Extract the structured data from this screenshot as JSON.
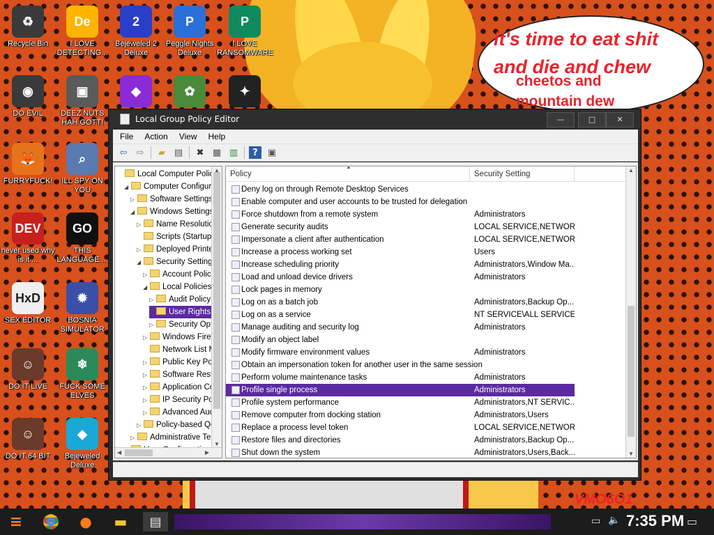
{
  "wallpaper": {
    "speech_line1": "it's time to eat shit",
    "speech_line2": "and die and chew",
    "speech_line3": "cheetos and",
    "speech_line4": "mountain dew",
    "corner_text": "VMO6O1"
  },
  "desktop_icons": [
    {
      "label": "Recycle Bin",
      "glyph": "♻",
      "color": "#3a3a3a"
    },
    {
      "label": "I LOVE DETECTING...",
      "glyph": "De",
      "color": "#ffb400"
    },
    {
      "label": "Bejeweled 2 Deluxe",
      "glyph": "2",
      "color": "#2a3fc8"
    },
    {
      "label": "Peggle Nights Deluxe",
      "glyph": "P",
      "color": "#2b6fd8"
    },
    {
      "label": "I LOVE RANSOMWARE",
      "glyph": "P",
      "color": "#0f8a5f"
    },
    {
      "label": "DO EVIL",
      "glyph": "◉",
      "color": "#3a3a3a"
    },
    {
      "label": "DEEZ NUTS HAH GOTTI",
      "glyph": "▣",
      "color": "#5a5a5a"
    },
    {
      "label": "",
      "glyph": "◆",
      "color": "#8b2bd8"
    },
    {
      "label": "",
      "glyph": "✿",
      "color": "#4a8a3a"
    },
    {
      "label": "",
      "glyph": "✦",
      "color": "#222"
    },
    {
      "label": "FURRYFUCK!",
      "glyph": "🦊",
      "color": "#e6731a"
    },
    {
      "label": "ILL SPY ON YOU",
      "glyph": "⌕",
      "color": "#5a7ab0"
    },
    {
      "label": "never used why is it ...",
      "glyph": "DEV",
      "color": "#c8201c"
    },
    {
      "label": "THIS LANGUAGE ...",
      "glyph": "GO",
      "color": "#101010"
    },
    {
      "label": "SEX EDITOR",
      "glyph": "HxD",
      "color": "#efefef"
    },
    {
      "label": "BOSNIA SIMULATOR",
      "glyph": "✹",
      "color": "#3a4fa8"
    },
    {
      "label": "DO IT LIVE",
      "glyph": "☺",
      "color": "#6a3a2a"
    },
    {
      "label": "FUCK SOME ELVES",
      "glyph": "❄",
      "color": "#2a8a5a"
    },
    {
      "label": "DO IT 64 BIT",
      "glyph": "☺",
      "color": "#6a3a2a"
    },
    {
      "label": "Bejeweled Deluxe",
      "glyph": "◆",
      "color": "#1aa8d8"
    }
  ],
  "window": {
    "title": "Local Group Policy Editor",
    "minimize": "—",
    "maximize": "□",
    "close": "✕",
    "menu": [
      "File",
      "Action",
      "View",
      "Help"
    ]
  },
  "tree": [
    {
      "label": "Local Computer Policy",
      "indent": 0,
      "arrow": "",
      "selected": false
    },
    {
      "label": "Computer Configuration",
      "indent": 1,
      "arrow": "◢",
      "selected": false
    },
    {
      "label": "Software Settings",
      "indent": 2,
      "arrow": "▷",
      "selected": false
    },
    {
      "label": "Windows Settings",
      "indent": 2,
      "arrow": "◢",
      "selected": false
    },
    {
      "label": "Name Resolution Policy",
      "indent": 3,
      "arrow": "▷",
      "selected": false
    },
    {
      "label": "Scripts (Startup/Shutdown)",
      "indent": 3,
      "arrow": "",
      "selected": false
    },
    {
      "label": "Deployed Printers",
      "indent": 3,
      "arrow": "▷",
      "selected": false
    },
    {
      "label": "Security Settings",
      "indent": 3,
      "arrow": "◢",
      "selected": false
    },
    {
      "label": "Account Policies",
      "indent": 4,
      "arrow": "▷",
      "selected": false
    },
    {
      "label": "Local Policies",
      "indent": 4,
      "arrow": "◢",
      "selected": false
    },
    {
      "label": "Audit Policy",
      "indent": 5,
      "arrow": "▷",
      "selected": false
    },
    {
      "label": "User Rights Assignment",
      "indent": 5,
      "arrow": "▷",
      "selected": true
    },
    {
      "label": "Security Options",
      "indent": 5,
      "arrow": "▷",
      "selected": false
    },
    {
      "label": "Windows Firewall",
      "indent": 4,
      "arrow": "▷",
      "selected": false
    },
    {
      "label": "Network List Manager",
      "indent": 4,
      "arrow": "",
      "selected": false
    },
    {
      "label": "Public Key Policies",
      "indent": 4,
      "arrow": "▷",
      "selected": false
    },
    {
      "label": "Software Restriction",
      "indent": 4,
      "arrow": "▷",
      "selected": false
    },
    {
      "label": "Application Control",
      "indent": 4,
      "arrow": "▷",
      "selected": false
    },
    {
      "label": "IP Security Policies",
      "indent": 4,
      "arrow": "▷",
      "selected": false
    },
    {
      "label": "Advanced Audit",
      "indent": 4,
      "arrow": "▷",
      "selected": false
    },
    {
      "label": "Policy-based QoS",
      "indent": 3,
      "arrow": "▷",
      "selected": false
    },
    {
      "label": "Administrative Templates",
      "indent": 2,
      "arrow": "▷",
      "selected": false
    },
    {
      "label": "User Configuration",
      "indent": 1,
      "arrow": "▷",
      "selected": false
    }
  ],
  "list": {
    "col_policy": "Policy",
    "col_setting": "Security Setting",
    "rows": [
      {
        "policy": "Deny log on through Remote Desktop Services",
        "setting": "",
        "selected": false
      },
      {
        "policy": "Enable computer and user accounts to be trusted for delegation",
        "setting": "",
        "selected": false
      },
      {
        "policy": "Force shutdown from a remote system",
        "setting": "Administrators",
        "selected": false
      },
      {
        "policy": "Generate security audits",
        "setting": "LOCAL SERVICE,NETWORK...",
        "selected": false
      },
      {
        "policy": "Impersonate a client after authentication",
        "setting": "LOCAL SERVICE,NETWORK...",
        "selected": false
      },
      {
        "policy": "Increase a process working set",
        "setting": "Users",
        "selected": false
      },
      {
        "policy": "Increase scheduling priority",
        "setting": "Administrators,Window Ma...",
        "selected": false
      },
      {
        "policy": "Load and unload device drivers",
        "setting": "Administrators",
        "selected": false
      },
      {
        "policy": "Lock pages in memory",
        "setting": "",
        "selected": false
      },
      {
        "policy": "Log on as a batch job",
        "setting": "Administrators,Backup Op...",
        "selected": false
      },
      {
        "policy": "Log on as a service",
        "setting": "NT SERVICE\\ALL SERVICES",
        "selected": false
      },
      {
        "policy": "Manage auditing and security log",
        "setting": "Administrators",
        "selected": false
      },
      {
        "policy": "Modify an object label",
        "setting": "",
        "selected": false
      },
      {
        "policy": "Modify firmware environment values",
        "setting": "Administrators",
        "selected": false
      },
      {
        "policy": "Obtain an impersonation token for another user in the same session",
        "setting": "",
        "selected": false
      },
      {
        "policy": "Perform volume maintenance tasks",
        "setting": "Administrators",
        "selected": false
      },
      {
        "policy": "Profile single process",
        "setting": "Administrators",
        "selected": true
      },
      {
        "policy": "Profile system performance",
        "setting": "Administrators,NT SERVIC...",
        "selected": false
      },
      {
        "policy": "Remove computer from docking station",
        "setting": "Administrators,Users",
        "selected": false
      },
      {
        "policy": "Replace a process level token",
        "setting": "LOCAL SERVICE,NETWORK...",
        "selected": false
      },
      {
        "policy": "Restore files and directories",
        "setting": "Administrators,Backup Op...",
        "selected": false
      },
      {
        "policy": "Shut down the system",
        "setting": "Administrators,Users,Back...",
        "selected": false
      }
    ]
  },
  "taskbar": {
    "clock": "7:35 PM",
    "start_glyph": "≡",
    "apps": [
      "chrome",
      "firefox",
      "file-explorer",
      "group-policy-editor"
    ]
  },
  "colors": {
    "selection": "#5b2aa0",
    "title_bar": "#2e2e2e"
  }
}
